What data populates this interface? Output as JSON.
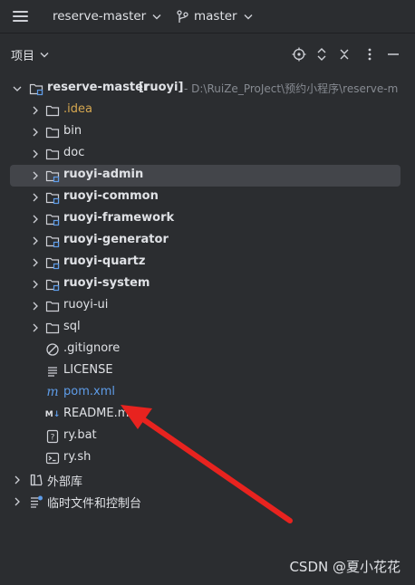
{
  "toolbar": {
    "project_name": "reserve-master",
    "branch_name": "master"
  },
  "panel": {
    "title": "项目"
  },
  "tree": {
    "root_name": "reserve-master",
    "root_module": "[ruoyi]",
    "root_path": "- D:\\RuiZe_ProJect\\预约小程序\\reserve-m",
    "items": [
      {
        "label": ".idea"
      },
      {
        "label": "bin"
      },
      {
        "label": "doc"
      },
      {
        "label": "ruoyi-admin"
      },
      {
        "label": "ruoyi-common"
      },
      {
        "label": "ruoyi-framework"
      },
      {
        "label": "ruoyi-generator"
      },
      {
        "label": "ruoyi-quartz"
      },
      {
        "label": "ruoyi-system"
      },
      {
        "label": "ruoyi-ui"
      },
      {
        "label": "sql"
      },
      {
        "label": ".gitignore"
      },
      {
        "label": "LICENSE"
      },
      {
        "label": "pom.xml"
      },
      {
        "label": "README.m"
      },
      {
        "label": "ry.bat"
      },
      {
        "label": "ry.sh"
      }
    ],
    "external_libraries": "外部库",
    "scratches": "临时文件和控制台"
  },
  "watermark": "CSDN @夏小花花",
  "colors": {
    "background": "#2b2d30",
    "selection": "#43454a",
    "folder_idea": "#d5a750",
    "pom_link": "#5e9ce8",
    "annotation_arrow": "#e8231f"
  }
}
